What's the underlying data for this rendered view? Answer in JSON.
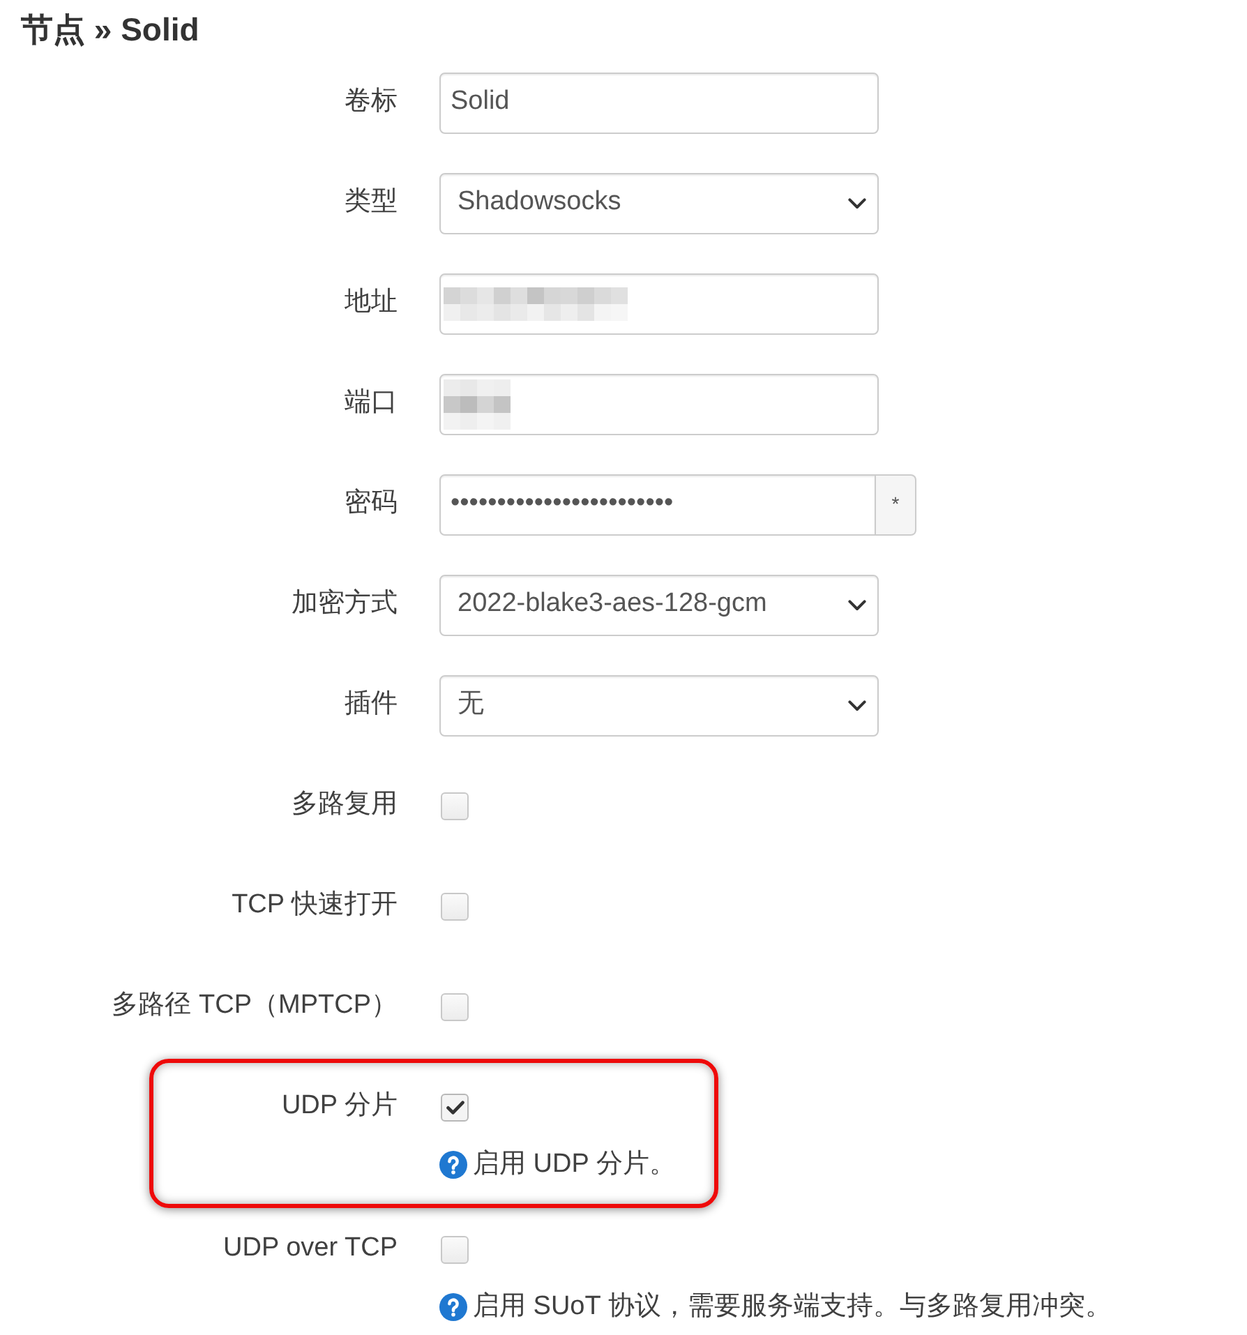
{
  "page": {
    "title": "节点 » Solid"
  },
  "fields": [
    {
      "kind": "text",
      "label": "卷标",
      "value": "Solid",
      "highlighted": false
    },
    {
      "kind": "select",
      "label": "类型",
      "value": "Shadowsocks",
      "highlighted": false
    },
    {
      "kind": "redacted",
      "label": "地址",
      "highlighted": false
    },
    {
      "kind": "redacted_short",
      "label": "端口",
      "highlighted": false
    },
    {
      "kind": "password",
      "label": "密码",
      "value": "••••••••••••••••••••••••",
      "reveal_button": "*",
      "highlighted": false
    },
    {
      "kind": "select",
      "label": "加密方式",
      "value": "2022-blake3-aes-128-gcm",
      "highlighted": false
    },
    {
      "kind": "select",
      "label": "插件",
      "value": "无",
      "highlighted": false
    },
    {
      "kind": "checkbox",
      "label": "多路复用",
      "checked": false,
      "highlighted": false
    },
    {
      "kind": "checkbox",
      "label": "TCP 快速打开",
      "checked": false,
      "highlighted": false
    },
    {
      "kind": "checkbox",
      "label": "多路径 TCP（MPTCP）",
      "checked": false,
      "highlighted": false
    },
    {
      "kind": "checkbox",
      "label": "UDP 分片",
      "checked": true,
      "help": "启用 UDP 分片。",
      "highlighted": true
    },
    {
      "kind": "checkbox",
      "label": "UDP over TCP",
      "checked": false,
      "help": "启用 SUoT 协议，需要服务端支持。与多路复用冲突。",
      "highlighted": false
    }
  ]
}
